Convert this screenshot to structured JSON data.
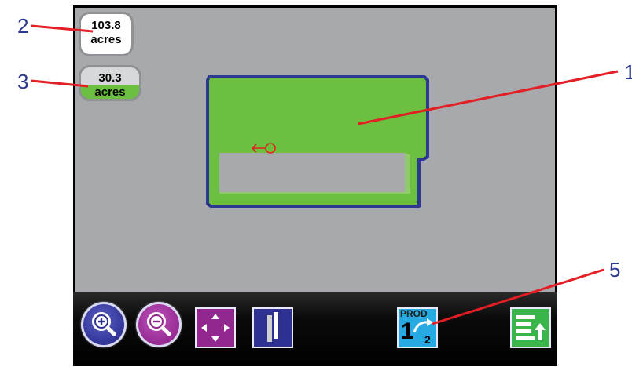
{
  "callouts": {
    "c1": "1",
    "c2": "2",
    "c3": "3",
    "c5": "5"
  },
  "field_area": {
    "value": "103.8",
    "unit": "acres"
  },
  "covered_area": {
    "value": "30.3",
    "unit": "acres"
  },
  "toolbar": {
    "product_switch_label": "PROD",
    "product_from": "1",
    "product_to": "2"
  },
  "colors": {
    "map_background": "#a7a9ac",
    "field_fill": "#6cbf3f",
    "field_boundary": "#2b3990",
    "callout_line": "#e31e24",
    "callout_text": "#2b3990",
    "zoom_in": "#2e3192",
    "zoom_out": "#92278f",
    "pan": "#92278f",
    "product_button": "#27aae1",
    "menu_button": "#39b54a"
  },
  "icons": {
    "zoom_in": "zoom-in-icon",
    "zoom_out": "zoom-out-icon",
    "pan": "pan-arrows-icon",
    "guidance": "guidance-bars-icon",
    "product_switch": "product-switch-icon",
    "menu": "menu-up-icon",
    "vehicle": "vehicle-position-icon"
  }
}
